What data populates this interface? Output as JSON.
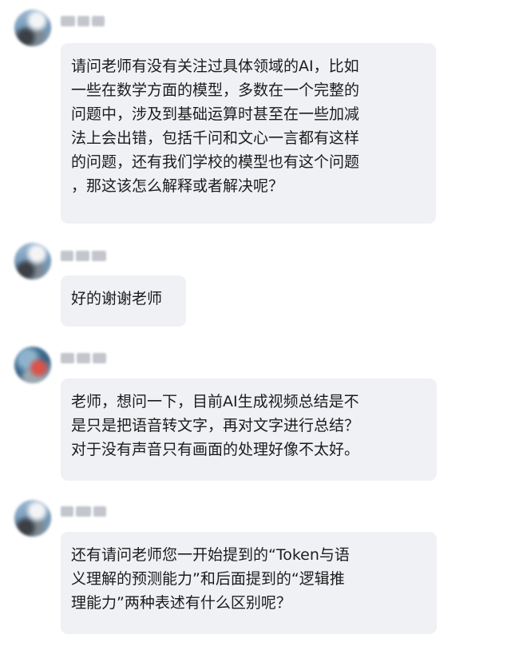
{
  "messages": [
    {
      "text": "请问老师有没有关注过具体领域的AI，比如\n一些在数学方面的模型，多数在一个完整的\n问题中，涉及到基础运算时甚至在一些加减\n法上会出错，包括千问和文心一言都有这样\n的问题，还有我们学校的模型也有这个问题\n，那这该怎么解释或者解决呢？"
    },
    {
      "text": "好的谢谢老师"
    },
    {
      "text": "老师，想问一下，目前AI生成视频总结是不\n是只是把语音转文字，再对文字进行总结？\n对于没有声音只有画面的处理好像不太好。"
    },
    {
      "text": "还有请问老师您一开始提到的“Token与语\n义理解的预测能力”和后面提到的“逻辑推\n理能力”两种表述有什么区别呢？"
    }
  ]
}
